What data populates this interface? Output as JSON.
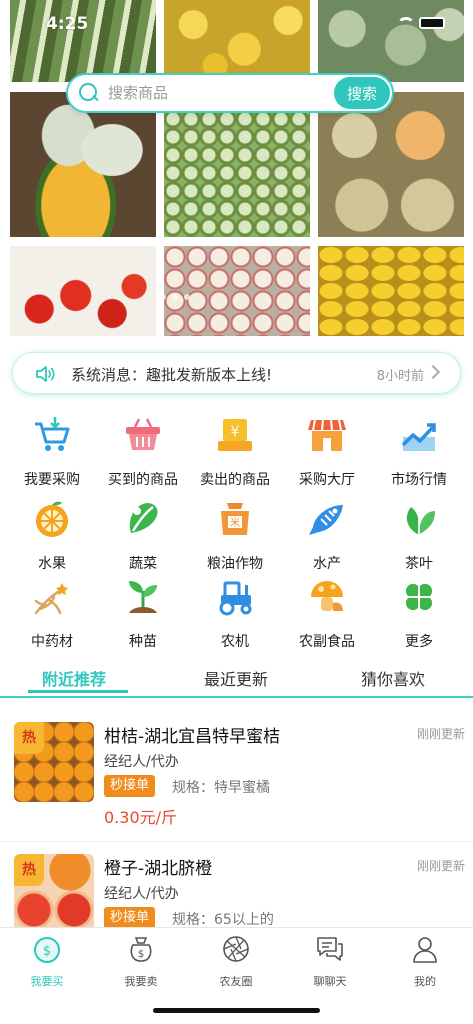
{
  "status_bar": {
    "time": "4:25"
  },
  "search": {
    "placeholder": "搜索商品",
    "button_label": "搜索"
  },
  "notice": {
    "text": "系统消息：趣批发新版本上线!",
    "time": "8小时前"
  },
  "categories": [
    {
      "label": "我要采购",
      "icon": "shopping-cart-icon"
    },
    {
      "label": "买到的商品",
      "icon": "basket-icon"
    },
    {
      "label": "卖出的商品",
      "icon": "money-box-icon"
    },
    {
      "label": "采购大厅",
      "icon": "storefront-icon"
    },
    {
      "label": "市场行情",
      "icon": "trend-chart-icon"
    },
    {
      "label": "水果",
      "icon": "orange-icon"
    },
    {
      "label": "蔬菜",
      "icon": "vegetable-icon"
    },
    {
      "label": "粮油作物",
      "icon": "grain-sack-icon"
    },
    {
      "label": "水产",
      "icon": "fish-icon"
    },
    {
      "label": "茶叶",
      "icon": "tea-leaf-icon"
    },
    {
      "label": "中药材",
      "icon": "ginseng-icon"
    },
    {
      "label": "种苗",
      "icon": "seedling-icon"
    },
    {
      "label": "农机",
      "icon": "tractor-icon"
    },
    {
      "label": "农副食品",
      "icon": "mushroom-icon"
    },
    {
      "label": "更多",
      "icon": "clover-icon"
    }
  ],
  "tabs": [
    {
      "label": "附近推荐",
      "active": true
    },
    {
      "label": "最近更新",
      "active": false
    },
    {
      "label": "猜你喜欢",
      "active": false
    }
  ],
  "products": [
    {
      "badge": "热",
      "title": "柑桔-湖北宜昌特早蜜桔",
      "updated": "刚刚更新",
      "agent": "经纪人/代办",
      "tag": "秒接单",
      "spec": "规格：特早蜜橘",
      "price": "0.30元/斤"
    },
    {
      "badge": "热",
      "title": "橙子-湖北脐橙",
      "updated": "刚刚更新",
      "agent": "经纪人/代办",
      "tag": "秒接单",
      "spec": "规格：65以上的"
    }
  ],
  "bottom_nav": [
    {
      "label": "我要买",
      "icon": "buy-icon",
      "active": true
    },
    {
      "label": "我要卖",
      "icon": "sell-icon",
      "active": false
    },
    {
      "label": "农友圈",
      "icon": "aperture-icon",
      "active": false
    },
    {
      "label": "聊聊天",
      "icon": "chat-icon",
      "active": false
    },
    {
      "label": "我的",
      "icon": "profile-icon",
      "active": false
    }
  ],
  "colors": {
    "accent": "#2fc7bd",
    "price": "#e8482f",
    "tag": "#f08c1e"
  }
}
